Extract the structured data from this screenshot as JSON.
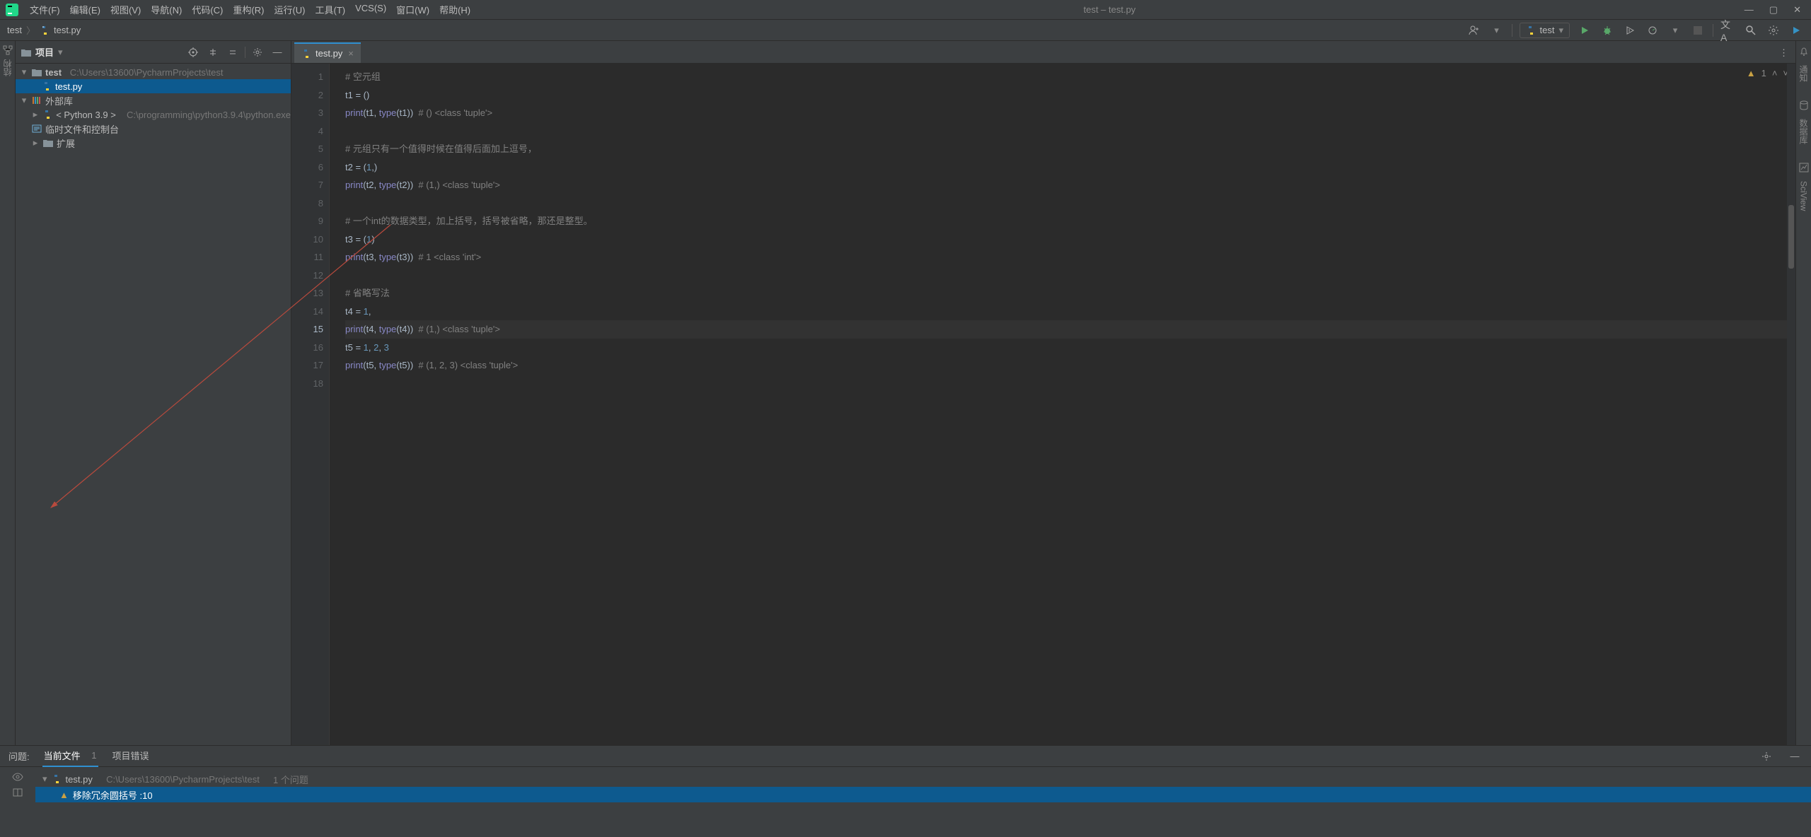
{
  "window": {
    "title": "test – test.py"
  },
  "menus": [
    "文件(F)",
    "编辑(E)",
    "视图(V)",
    "导航(N)",
    "代码(C)",
    "重构(R)",
    "运行(U)",
    "工具(T)",
    "VCS(S)",
    "窗口(W)",
    "帮助(H)"
  ],
  "breadcrumbs": {
    "root": "test",
    "file": "test.py"
  },
  "runConfig": {
    "name": "test"
  },
  "projectPanel": {
    "title": "项目",
    "tree": {
      "root": {
        "name": "test",
        "path": "C:\\Users\\13600\\PycharmProjects\\test"
      },
      "file": "test.py",
      "extLib": "外部库",
      "python": {
        "label": "< Python 3.9 >",
        "path": "C:\\programming\\python3.9.4\\python.exe"
      },
      "scratch": "临时文件和控制台",
      "ext": "扩展"
    }
  },
  "editorTab": {
    "name": "test.py"
  },
  "inspection": {
    "warnings": "1"
  },
  "code": {
    "lines": [
      {
        "n": 1,
        "seg": [
          [
            "com",
            "# 空元组"
          ]
        ]
      },
      {
        "n": 2,
        "seg": [
          [
            "var",
            "t1"
          ],
          [
            "op",
            " = "
          ],
          [
            "par",
            "()"
          ]
        ]
      },
      {
        "n": 3,
        "seg": [
          [
            "fn",
            "print"
          ],
          [
            "par",
            "("
          ],
          [
            "var",
            "t1"
          ],
          [
            "op",
            ", "
          ],
          [
            "fn",
            "type"
          ],
          [
            "par",
            "("
          ],
          [
            "var",
            "t1"
          ],
          [
            "par",
            "))"
          ],
          [
            "plain",
            "  "
          ],
          [
            "com",
            "# () <class 'tuple'>"
          ]
        ]
      },
      {
        "n": 4,
        "seg": []
      },
      {
        "n": 5,
        "seg": [
          [
            "com",
            "# 元组只有一个值得时候在值得后面加上逗号，"
          ]
        ]
      },
      {
        "n": 6,
        "seg": [
          [
            "var",
            "t2"
          ],
          [
            "op",
            " = "
          ],
          [
            "par",
            "("
          ],
          [
            "num",
            "1"
          ],
          [
            "op",
            ","
          ],
          [
            "par",
            ")"
          ]
        ]
      },
      {
        "n": 7,
        "seg": [
          [
            "fn",
            "print"
          ],
          [
            "par",
            "("
          ],
          [
            "var",
            "t2"
          ],
          [
            "op",
            ", "
          ],
          [
            "fn",
            "type"
          ],
          [
            "par",
            "("
          ],
          [
            "var",
            "t2"
          ],
          [
            "par",
            "))"
          ],
          [
            "plain",
            "  "
          ],
          [
            "com",
            "# (1,) <class 'tuple'>"
          ]
        ]
      },
      {
        "n": 8,
        "seg": []
      },
      {
        "n": 9,
        "seg": [
          [
            "com",
            "# 一个int的数据类型，加上括号，括号被省略，那还是整型。"
          ]
        ]
      },
      {
        "n": 10,
        "seg": [
          [
            "var",
            "t3"
          ],
          [
            "op",
            " = "
          ],
          [
            "par",
            "("
          ],
          [
            "num",
            "1"
          ],
          [
            "par",
            ")"
          ]
        ]
      },
      {
        "n": 11,
        "seg": [
          [
            "fn",
            "print"
          ],
          [
            "par",
            "("
          ],
          [
            "var",
            "t3"
          ],
          [
            "op",
            ", "
          ],
          [
            "fn",
            "type"
          ],
          [
            "par",
            "("
          ],
          [
            "var",
            "t3"
          ],
          [
            "par",
            "))"
          ],
          [
            "plain",
            "  "
          ],
          [
            "com",
            "# 1 <class 'int'>"
          ]
        ]
      },
      {
        "n": 12,
        "seg": []
      },
      {
        "n": 13,
        "seg": [
          [
            "com",
            "# 省略写法"
          ]
        ]
      },
      {
        "n": 14,
        "seg": [
          [
            "var",
            "t4"
          ],
          [
            "op",
            " = "
          ],
          [
            "num",
            "1"
          ],
          [
            "op",
            ","
          ]
        ]
      },
      {
        "n": 15,
        "hl": true,
        "seg": [
          [
            "fn",
            "print"
          ],
          [
            "par",
            "("
          ],
          [
            "var",
            "t4"
          ],
          [
            "op",
            ", "
          ],
          [
            "fn",
            "type"
          ],
          [
            "par",
            "("
          ],
          [
            "var",
            "t4"
          ],
          [
            "par",
            "))"
          ],
          [
            "plain",
            "  "
          ],
          [
            "com",
            "# (1,) <class 'tuple'>"
          ]
        ]
      },
      {
        "n": 16,
        "seg": [
          [
            "var",
            "t5"
          ],
          [
            "op",
            " = "
          ],
          [
            "num",
            "1"
          ],
          [
            "op",
            ", "
          ],
          [
            "num",
            "2"
          ],
          [
            "op",
            ", "
          ],
          [
            "num",
            "3"
          ]
        ]
      },
      {
        "n": 17,
        "seg": [
          [
            "fn",
            "print"
          ],
          [
            "par",
            "("
          ],
          [
            "var",
            "t5"
          ],
          [
            "op",
            ", "
          ],
          [
            "fn",
            "type"
          ],
          [
            "par",
            "("
          ],
          [
            "var",
            "t5"
          ],
          [
            "par",
            "))"
          ],
          [
            "plain",
            "  "
          ],
          [
            "com",
            "# (1, 2, 3) <class 'tuple'>"
          ]
        ]
      },
      {
        "n": 18,
        "seg": []
      }
    ],
    "currentLine": 15
  },
  "problems": {
    "title": "问题:",
    "tabs": {
      "current": "当前文件",
      "currentCount": "1",
      "project": "项目错误"
    },
    "fileRow": {
      "file": "test.py",
      "path": "C:\\Users\\13600\\PycharmProjects\\test",
      "count": "1 个问题"
    },
    "issue": {
      "text": "移除冗余圆括号 :10"
    }
  },
  "rightTools": [
    "通知",
    "数据库",
    "SciView"
  ]
}
